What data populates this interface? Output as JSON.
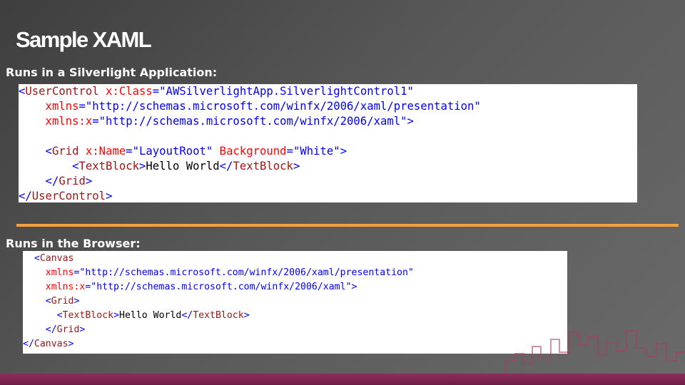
{
  "slide": {
    "title": "Sample XAML",
    "section1_label": "Runs in a Silverlight Application:",
    "section2_label": "Runs in the Browser:"
  },
  "code_block_1": {
    "lines": [
      [
        {
          "t": "<",
          "c": "c-punc"
        },
        {
          "t": "User",
          "c": "c-tag"
        },
        {
          "t": "Control",
          "c": "c-tag"
        },
        {
          "t": " x:Class",
          "c": "c-attr"
        },
        {
          "t": "=\"AWSilverlightApp.SilverlightControl1\"",
          "c": "c-val"
        }
      ],
      [
        {
          "t": "    xmlns",
          "c": "c-attr"
        },
        {
          "t": "=\"http://schemas.microsoft.com/winfx/2006/xaml/presentation\"",
          "c": "c-val"
        }
      ],
      [
        {
          "t": "    xmlns:x",
          "c": "c-attr"
        },
        {
          "t": "=\"http://schemas.microsoft.com/winfx/2006/xaml\"",
          "c": "c-val"
        },
        {
          "t": ">",
          "c": "c-punc"
        }
      ],
      [
        {
          "t": " ",
          "c": "c-text"
        }
      ],
      [
        {
          "t": "    <",
          "c": "c-punc"
        },
        {
          "t": "Grid",
          "c": "c-tag"
        },
        {
          "t": " x:Name",
          "c": "c-attr"
        },
        {
          "t": "=\"LayoutRoot\"",
          "c": "c-val"
        },
        {
          "t": " Background",
          "c": "c-attr"
        },
        {
          "t": "=\"White\"",
          "c": "c-val"
        },
        {
          "t": ">",
          "c": "c-punc"
        }
      ],
      [
        {
          "t": "        <",
          "c": "c-punc"
        },
        {
          "t": "TextBlock",
          "c": "c-tag"
        },
        {
          "t": ">",
          "c": "c-punc"
        },
        {
          "t": "Hello World",
          "c": "c-text"
        },
        {
          "t": "</",
          "c": "c-punc"
        },
        {
          "t": "TextBlock",
          "c": "c-tag"
        },
        {
          "t": ">",
          "c": "c-punc"
        }
      ],
      [
        {
          "t": "    </",
          "c": "c-punc"
        },
        {
          "t": "Grid",
          "c": "c-tag"
        },
        {
          "t": ">",
          "c": "c-punc"
        }
      ],
      [
        {
          "t": "</",
          "c": "c-punc"
        },
        {
          "t": "UserControl",
          "c": "c-tag"
        },
        {
          "t": ">",
          "c": "c-punc"
        }
      ]
    ]
  },
  "code_block_2": {
    "lines": [
      [
        {
          "t": "  <",
          "c": "c-punc"
        },
        {
          "t": "Canvas",
          "c": "c-tag"
        }
      ],
      [
        {
          "t": "    xmlns",
          "c": "c-attr"
        },
        {
          "t": "=\"http://schemas.microsoft.com/winfx/2006/xaml/presentation\"",
          "c": "c-val"
        }
      ],
      [
        {
          "t": "    xmlns:x",
          "c": "c-attr"
        },
        {
          "t": "=\"http://schemas.microsoft.com/winfx/2006/xaml\"",
          "c": "c-val"
        },
        {
          "t": ">",
          "c": "c-punc"
        }
      ],
      [
        {
          "t": "    <",
          "c": "c-punc"
        },
        {
          "t": "Grid",
          "c": "c-tag"
        },
        {
          "t": ">",
          "c": "c-punc"
        }
      ],
      [
        {
          "t": "      <",
          "c": "c-punc"
        },
        {
          "t": "TextBlock",
          "c": "c-tag"
        },
        {
          "t": ">",
          "c": "c-punc"
        },
        {
          "t": "Hello World",
          "c": "c-text"
        },
        {
          "t": "</",
          "c": "c-punc"
        },
        {
          "t": "TextBlock",
          "c": "c-tag"
        },
        {
          "t": ">",
          "c": "c-punc"
        }
      ],
      [
        {
          "t": "    </",
          "c": "c-punc"
        },
        {
          "t": "Grid",
          "c": "c-tag"
        },
        {
          "t": ">",
          "c": "c-punc"
        }
      ],
      [
        {
          "t": "</",
          "c": "c-punc"
        },
        {
          "t": "Canvas",
          "c": "c-tag"
        },
        {
          "t": ">",
          "c": "c-punc"
        }
      ]
    ]
  },
  "colors": {
    "tag": "#a31515",
    "attribute": "#ff0000",
    "value": "#0000ff",
    "divider": "#f2a23c",
    "bottom_band": "#6b1f46"
  }
}
